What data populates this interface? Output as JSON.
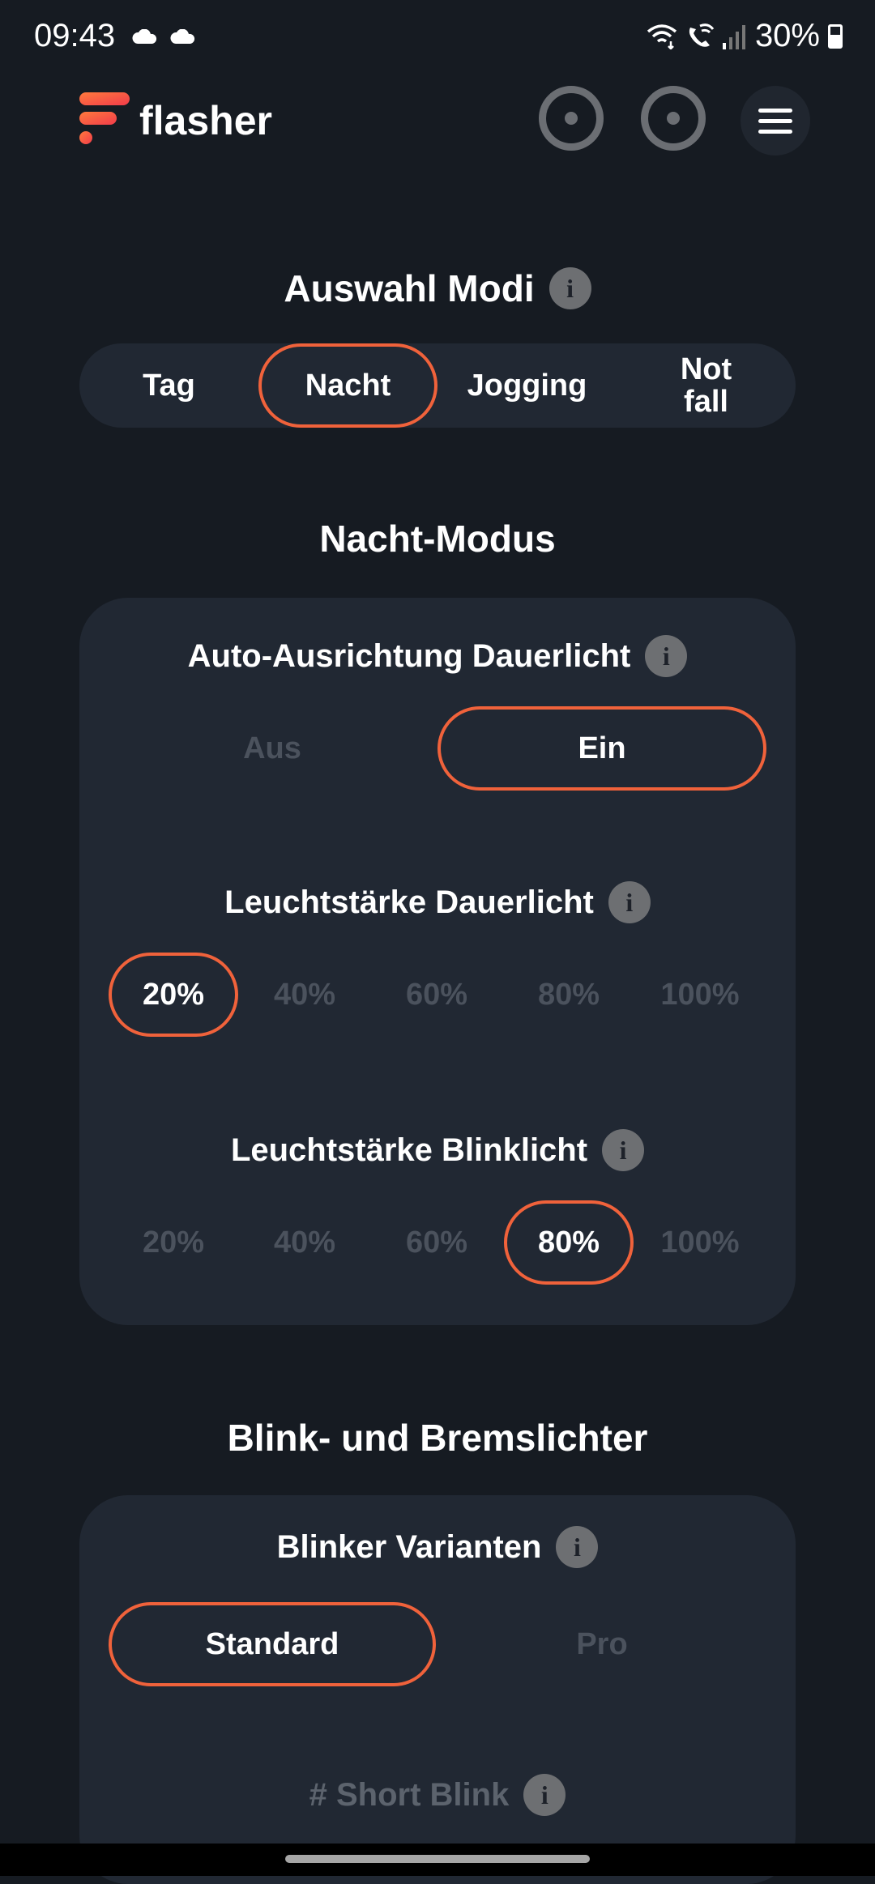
{
  "status_bar": {
    "time": "09:43",
    "battery": "30%"
  },
  "header": {
    "brand": "flasher"
  },
  "modes": {
    "title": "Auswahl Modi",
    "options": [
      "Tag",
      "Nacht",
      "Jogging",
      "Not\nfall"
    ],
    "selected": "Nacht"
  },
  "night_mode": {
    "title": "Nacht-Modus",
    "auto_align": {
      "title": "Auto-Ausrichtung Dauerlicht",
      "off": "Aus",
      "on": "Ein",
      "selected": "Ein"
    },
    "steady_brightness": {
      "title": "Leuchtstärke Dauerlicht",
      "options": [
        "20%",
        "40%",
        "60%",
        "80%",
        "100%"
      ],
      "selected": "20%"
    },
    "blink_brightness": {
      "title": "Leuchtstärke Blinklicht",
      "options": [
        "20%",
        "40%",
        "60%",
        "80%",
        "100%"
      ],
      "selected": "80%"
    }
  },
  "blink_section": {
    "title": "Blink- und Bremslichter",
    "variants": {
      "title": "Blinker Varianten",
      "options": [
        "Standard",
        "Pro"
      ],
      "selected": "Standard"
    },
    "short_blink": {
      "title": "# Short Blink"
    }
  },
  "colors": {
    "background": "#161b22",
    "card": "#212833",
    "accent": "#f0623b",
    "inactive_text": "#4b525d",
    "info_icon": "#6d6f72"
  },
  "icons": {
    "info": "i"
  }
}
